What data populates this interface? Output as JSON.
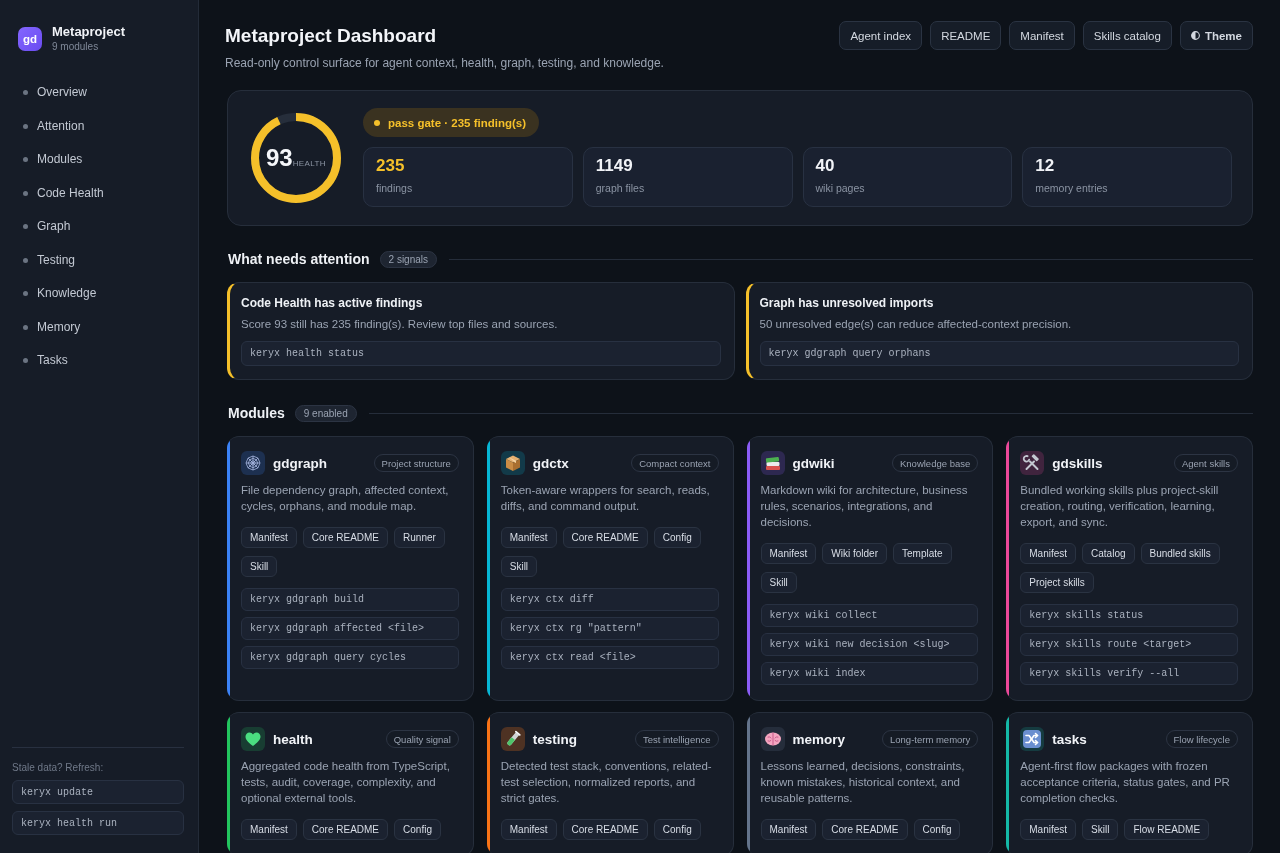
{
  "sidebar": {
    "logo": "gd",
    "title": "Metaproject",
    "subtitle": "9 modules",
    "nav": [
      {
        "label": "Overview",
        "selected": false
      },
      {
        "label": "Attention",
        "selected": false
      },
      {
        "label": "Modules",
        "selected": false
      },
      {
        "label": "Code Health",
        "selected": false
      },
      {
        "label": "Graph",
        "selected": false
      },
      {
        "label": "Testing",
        "selected": false
      },
      {
        "label": "Knowledge",
        "selected": false
      },
      {
        "label": "Memory",
        "selected": false
      },
      {
        "label": "Tasks",
        "selected": false
      }
    ],
    "refresh": {
      "label": "Stale data? Refresh:",
      "commands": [
        "keryx update",
        "keryx health run"
      ]
    }
  },
  "header": {
    "title": "Metaproject Dashboard",
    "subtitle": "Read-only control surface for agent context, health, graph, testing, and knowledge.",
    "buttons": [
      {
        "label": "Agent index",
        "kind": "link"
      },
      {
        "label": "README",
        "kind": "link"
      },
      {
        "label": "Manifest",
        "kind": "link"
      },
      {
        "label": "Skills catalog",
        "kind": "link"
      },
      {
        "label": "Theme",
        "kind": "theme"
      }
    ]
  },
  "hero": {
    "health": {
      "value": "93",
      "caption": "HEALTH",
      "level": 0.93
    },
    "gate": "pass gate · 235 finding(s)",
    "stats": [
      {
        "value": "235",
        "label": "findings",
        "warning": true
      },
      {
        "value": "1149",
        "label": "graph files",
        "warning": false
      },
      {
        "value": "40",
        "label": "wiki pages",
        "warning": false
      },
      {
        "value": "12",
        "label": "memory entries",
        "warning": false
      }
    ]
  },
  "attention": {
    "title": "What needs attention",
    "count": "2 signals",
    "items": [
      {
        "title": "Code Health has active findings",
        "text": "Score 93 still has 235 finding(s). Review top files and sources.",
        "command": "keryx health status"
      },
      {
        "title": "Graph has unresolved imports",
        "text": "50 unresolved edge(s) can reduce affected-context precision.",
        "command": "keryx gdgraph query orphans"
      }
    ]
  },
  "modules": {
    "title": "Modules",
    "count": "9 enabled",
    "items": [
      {
        "name": "gdgraph",
        "tag": "Project structure",
        "color": "#3b82f6",
        "description": "File dependency graph, affected context, cycles, orphans, and module map.",
        "links": [
          "Manifest",
          "Core README",
          "Runner",
          "Skill"
        ],
        "commands": [
          "keryx gdgraph build",
          "keryx gdgraph affected <file>",
          "keryx gdgraph query cycles"
        ]
      },
      {
        "name": "gdctx",
        "tag": "Compact context",
        "color": "#06b6d4",
        "description": "Token-aware wrappers for search, reads, diffs, and command output.",
        "links": [
          "Manifest",
          "Core README",
          "Config",
          "Skill"
        ],
        "commands": [
          "keryx ctx diff",
          "keryx ctx rg \"pattern\"",
          "keryx ctx read <file>"
        ]
      },
      {
        "name": "gdwiki",
        "tag": "Knowledge base",
        "color": "#8b5cf6",
        "description": "Markdown wiki for architecture, business rules, scenarios, integrations, and decisions.",
        "links": [
          "Manifest",
          "Wiki folder",
          "Template",
          "Skill"
        ],
        "commands": [
          "keryx wiki collect",
          "keryx wiki new decision <slug>",
          "keryx wiki index"
        ]
      },
      {
        "name": "gdskills",
        "tag": "Agent skills",
        "color": "#ec4899",
        "description": "Bundled working skills plus project-skill creation, routing, verification, learning, export, and sync.",
        "links": [
          "Manifest",
          "Catalog",
          "Bundled skills",
          "Project skills"
        ],
        "commands": [
          "keryx skills status",
          "keryx skills route <target>",
          "keryx skills verify --all"
        ]
      },
      {
        "name": "health",
        "tag": "Quality signal",
        "color": "#22c55e",
        "description": "Aggregated code health from TypeScript, tests, audit, coverage, complexity, and optional external tools.",
        "links": [
          "Manifest",
          "Core README",
          "Config"
        ]
      },
      {
        "name": "testing",
        "tag": "Test intelligence",
        "color": "#f97316",
        "description": "Detected test stack, conventions, related-test selection, normalized reports, and strict gates.",
        "links": [
          "Manifest",
          "Core README",
          "Config"
        ]
      },
      {
        "name": "memory",
        "tag": "Long-term memory",
        "color": "#64748b",
        "description": "Lessons learned, decisions, constraints, known mistakes, historical context, and reusable patterns.",
        "links": [
          "Manifest",
          "Core README",
          "Config"
        ]
      },
      {
        "name": "tasks",
        "tag": "Flow lifecycle",
        "color": "#14b8a6",
        "description": "Agent-first flow packages with frozen acceptance criteria, status gates, and PR completion checks.",
        "links": [
          "Manifest",
          "Skill",
          "Flow README"
        ]
      }
    ]
  }
}
